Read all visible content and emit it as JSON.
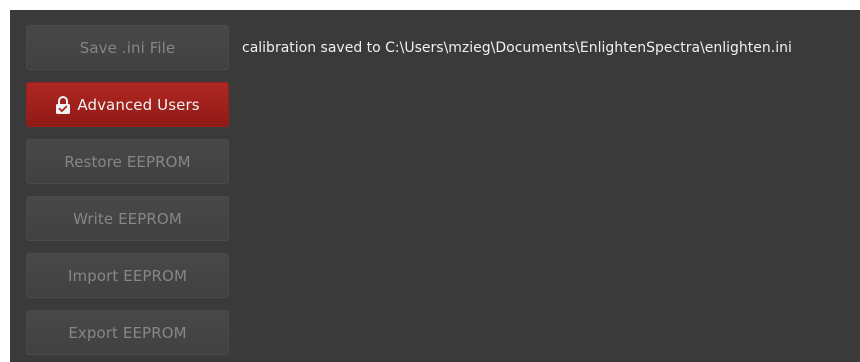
{
  "buttons": {
    "save_ini": "Save .ini File",
    "advanced_users": "Advanced Users",
    "restore_eeprom": "Restore EEPROM",
    "write_eeprom": "Write EEPROM",
    "import_eeprom": "Import EEPROM",
    "export_eeprom": "Export EEPROM"
  },
  "status_text": "calibration saved to C:\\Users\\mzieg\\Documents\\EnlightenSpectra\\enlighten.ini",
  "icons": {
    "advanced_users": "lock-icon"
  },
  "colors": {
    "background": "#3a3a3a",
    "button": "#444444",
    "button_text": "#868686",
    "advanced_button": "#a8231e",
    "status_text": "#f0f0f0"
  }
}
